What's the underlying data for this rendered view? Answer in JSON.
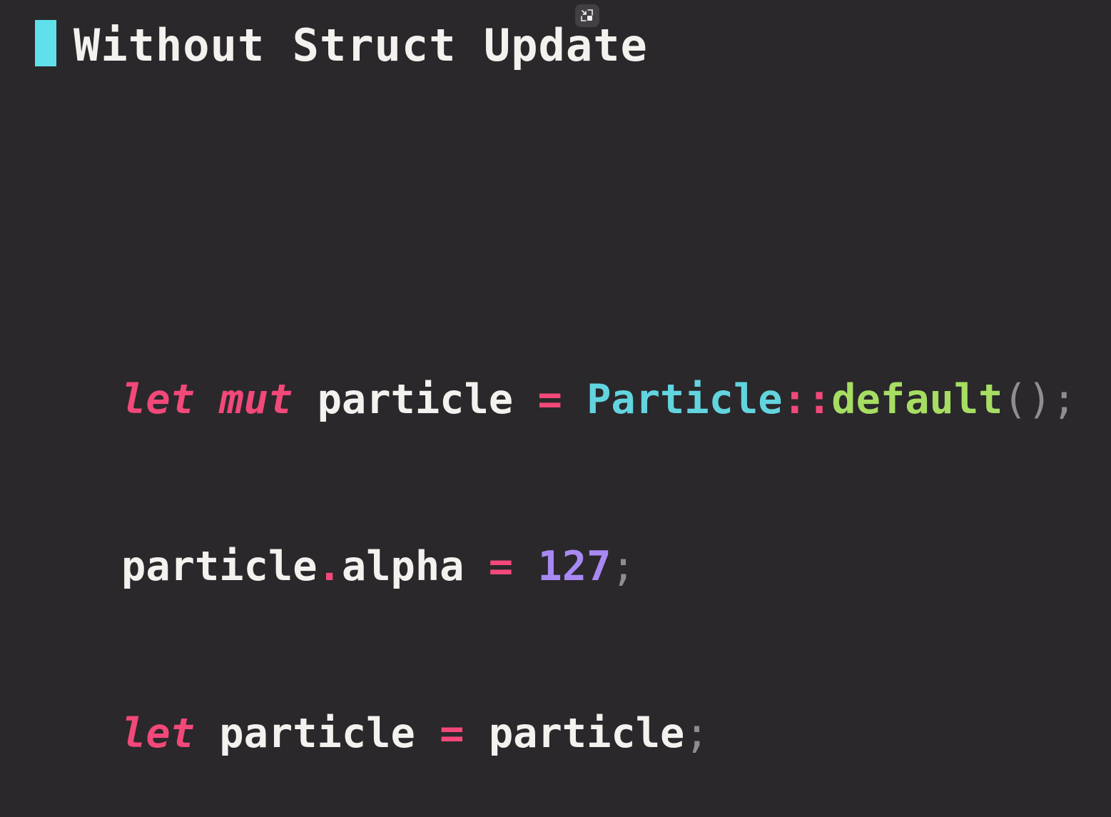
{
  "slide": {
    "title": "Without Struct Update"
  },
  "restore_button": {
    "icon": "restore-window-icon"
  },
  "code": {
    "line1": {
      "kw_let": "let",
      "kw_mut": "mut",
      "ident": "particle",
      "eq": "=",
      "type": "Particle",
      "path_sep": "::",
      "fn": "default",
      "parens": "()",
      "semi": ";"
    },
    "line2": {
      "ident": "particle",
      "dot": ".",
      "field": "alpha",
      "eq": "=",
      "num": "127",
      "semi": ";"
    },
    "line3": {
      "kw_let": "let",
      "ident": "particle",
      "eq": "=",
      "value": "particle",
      "semi": ";"
    }
  },
  "colors": {
    "background": "#2a282b",
    "accent_bar": "#5fe0ea",
    "keyword": "#f2487a",
    "type": "#62d4df",
    "function": "#a6dd62",
    "number": "#a889f3",
    "text": "#f4f2ee",
    "punctuation": "#8f8d8f"
  }
}
